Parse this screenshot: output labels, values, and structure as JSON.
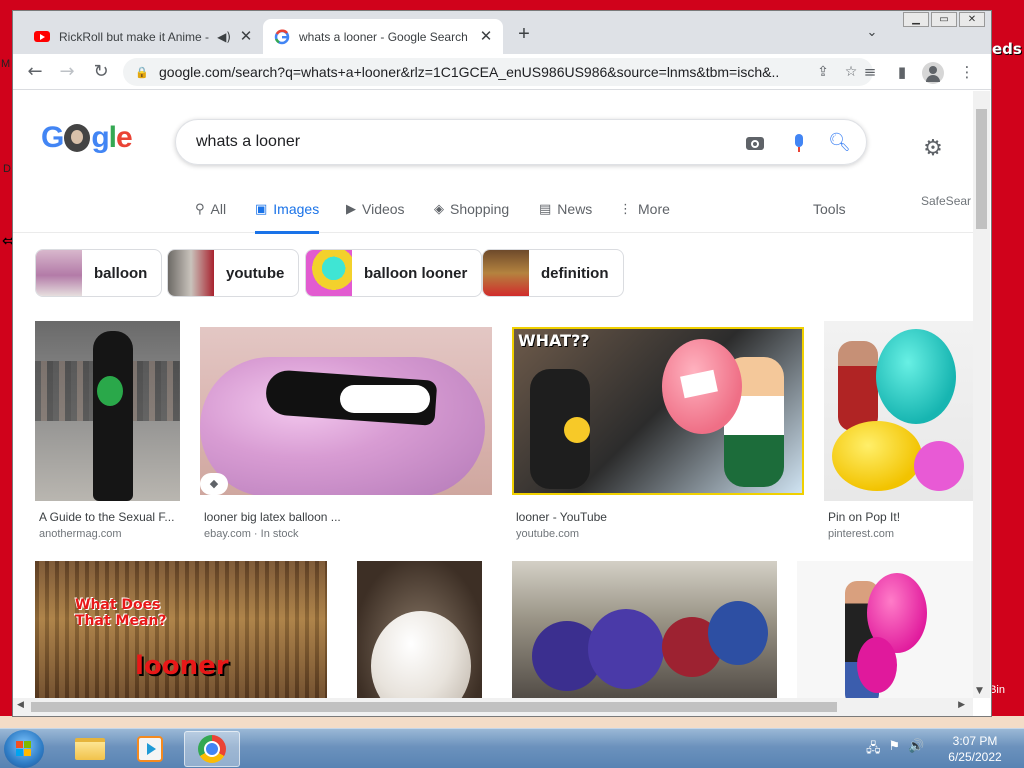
{
  "desktop": {
    "right_text": "eds",
    "left_m": "M",
    "left_d": "D",
    "bin_label": "Bin"
  },
  "browser": {
    "tabs": [
      {
        "title": "RickRoll but make it Anime -",
        "icon": "youtube-icon",
        "audio": true
      },
      {
        "title": "whats a looner - Google Search",
        "icon": "google-icon",
        "active": true
      }
    ],
    "url": "google.com/search?q=whats+a+looner&rlz=1C1GCEA_enUS986US986&source=lnms&tbm=isch&..."
  },
  "search": {
    "query": "whats a looner",
    "tabs": [
      {
        "label": "All",
        "icon": "search-icon"
      },
      {
        "label": "Images",
        "icon": "image-icon",
        "active": true
      },
      {
        "label": "Videos",
        "icon": "video-icon"
      },
      {
        "label": "Shopping",
        "icon": "tag-icon"
      },
      {
        "label": "News",
        "icon": "news-icon"
      },
      {
        "label": "More",
        "icon": "more-vert-icon"
      }
    ],
    "tools_label": "Tools",
    "safesearch_label": "SafeSear",
    "chips": [
      {
        "label": "balloon"
      },
      {
        "label": "youtube"
      },
      {
        "label": "balloon looner"
      },
      {
        "label": "definition"
      }
    ],
    "results": [
      {
        "caption": "A Guide to the Sexual F...",
        "source": "anothermag.com"
      },
      {
        "caption": "looner big latex balloon ...",
        "source": "ebay.com · In stock"
      },
      {
        "caption": "looner - YouTube",
        "source": "youtube.com"
      },
      {
        "caption": "Pin on Pop It!",
        "source": "pinterest.com"
      }
    ],
    "image_text": {
      "what": "WHAT??",
      "what_does": "What Does\nThat Mean?",
      "looner": "looner"
    }
  },
  "taskbar": {
    "time": "3:07 PM",
    "date": "6/25/2022"
  },
  "colors": {
    "desktop_red": "#d0021b",
    "google_blue": "#1a73e8",
    "taskbar_blue": "#6c92bd"
  }
}
